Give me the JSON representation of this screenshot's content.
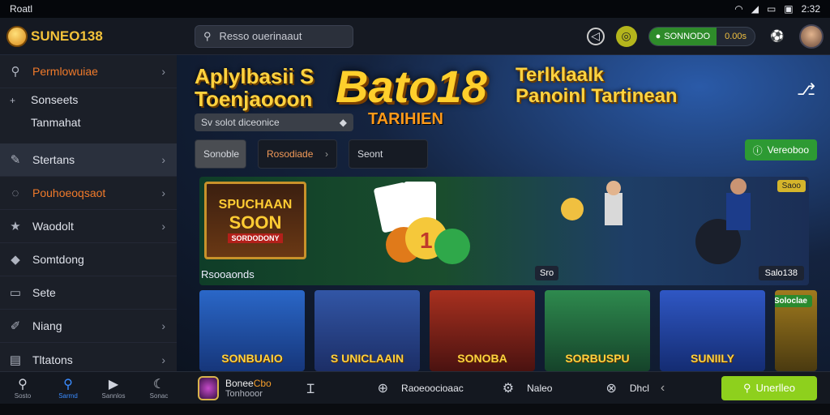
{
  "status": {
    "carrier": "Roatl",
    "time": "2:32"
  },
  "header": {
    "logo": "SUNEO138",
    "search_placeholder": "Resso ouerinaaut",
    "wallet_label": "SONNODO",
    "wallet_amount": "0.00s"
  },
  "sidebar": {
    "items": [
      {
        "label": "Permlowuiae",
        "icon": "search-icon",
        "orange": true
      },
      {
        "label": "Sonseets"
      },
      {
        "label": "Tanmahat"
      },
      {
        "label": "Stertans",
        "icon": "edit-icon"
      },
      {
        "label": "Pouhoeoqsaot",
        "icon": "chat-icon",
        "orange": true
      },
      {
        "label": "Waodolt",
        "icon": "star-icon"
      },
      {
        "label": "Somtdong",
        "icon": "tag-icon"
      },
      {
        "label": "Sete",
        "icon": "monitor-icon"
      },
      {
        "label": "Niang",
        "icon": "pencil-icon"
      },
      {
        "label": "Tltatons",
        "icon": "ticket-icon"
      }
    ]
  },
  "hero": {
    "title_line1": "Aplylbasii S",
    "title_line2": "Toenjaooon",
    "brand": "Bato18",
    "tagline": "TARIHIEN",
    "right_line1": "Terlklaalk",
    "right_line2": "Panoinl Tartinean",
    "search_text": "Sv solot diceonice",
    "tabs": [
      "Sonoble",
      "Rosodiade",
      "Seont"
    ],
    "view_button": "Vereoboo"
  },
  "banner": {
    "tile_text1": "SPUCHAAN",
    "tile_text2": "SOON",
    "tile_text3": "SORDODONY",
    "label": "Rsooaonds",
    "badge_new": "Saoo",
    "badge_left": "Sro",
    "badge_right": "Salo138"
  },
  "games": [
    {
      "title": "SONBUAIO",
      "bg": "#1f4d9e"
    },
    {
      "title": "S UNICLAAIN",
      "bg": "#27407e"
    },
    {
      "title": "SONOBA",
      "bg": "#7a1f16"
    },
    {
      "title": "SORBUSPU",
      "bg": "#21663b"
    },
    {
      "title": "SUNIILY",
      "bg": "#1b3f9a"
    },
    {
      "title": "",
      "bg": "#7c5b16",
      "badge": "Soloclae"
    }
  ],
  "bottom": {
    "nav": [
      {
        "label": "Sosto",
        "icon": "search-icon"
      },
      {
        "label": "Sarmd",
        "icon": "search-icon",
        "active": true
      },
      {
        "label": "Sannlos",
        "icon": "video-icon"
      },
      {
        "label": "Sonac",
        "icon": "moon-icon"
      }
    ],
    "promo_title": "Bonee",
    "promo_highlight": "Cbo",
    "promo_sub": "Tonhooor",
    "items": [
      "Raoeoocioaac",
      "Naleo",
      "Dhcl"
    ],
    "cta": "Unerlleo"
  }
}
